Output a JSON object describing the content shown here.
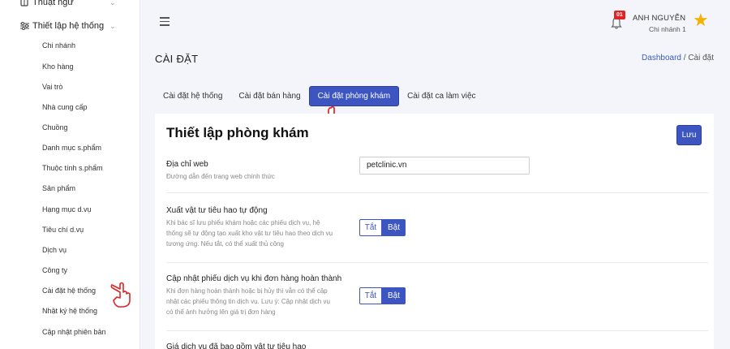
{
  "sidebar": {
    "group_top": {
      "label": "Thuật ngữ",
      "icon": "book-icon"
    },
    "group_settings": {
      "label": "Thiết lập hệ thống",
      "icon": "sliders-icon"
    },
    "items": [
      {
        "label": "Chi nhánh"
      },
      {
        "label": "Kho hàng"
      },
      {
        "label": "Vai trò"
      },
      {
        "label": "Nhà cung cấp"
      },
      {
        "label": "Chuồng"
      },
      {
        "label": "Danh mục s.phẩm"
      },
      {
        "label": "Thuộc tính s.phẩm"
      },
      {
        "label": "Sản phẩm"
      },
      {
        "label": "Hạng mục d.vụ"
      },
      {
        "label": "Tiêu chí d.vụ"
      },
      {
        "label": "Dịch vụ"
      },
      {
        "label": "Công ty"
      },
      {
        "label": "Cài đặt hệ thống"
      },
      {
        "label": "Nhật ký hệ thống"
      },
      {
        "label": "Cập nhật phiên bản"
      }
    ]
  },
  "header": {
    "notification_count": "01",
    "user_name": "ANH NGUYỄN",
    "user_branch": "Chi nhánh 1"
  },
  "page": {
    "title": "CÀI ĐẶT",
    "breadcrumb_home": "Dashboard",
    "breadcrumb_sep": "/",
    "breadcrumb_current": "Cài đặt"
  },
  "tabs": [
    {
      "label": "Cài đặt hệ thống",
      "active": false
    },
    {
      "label": "Cài đặt bán hàng",
      "active": false
    },
    {
      "label": "Cài đặt phòng khám",
      "active": true
    },
    {
      "label": "Cài đặt ca làm việc",
      "active": false
    }
  ],
  "card": {
    "title": "Thiết lập phòng khám",
    "save_label": "Lưu",
    "settings": [
      {
        "label": "Địa chỉ web",
        "desc": "Đường dẫn đến trang web chính thức",
        "value": "petclinic.vn"
      },
      {
        "label": "Xuất vật tư tiêu hao tự động",
        "desc": "Khi bác sĩ lưu phiếu khám hoặc các phiếu dịch vụ, hệ thống sẽ tự động tạo xuất kho vật tư tiêu hao theo dịch vụ tương ứng. Nếu tắt, có thể xuất thủ công",
        "off_label": "Tắt",
        "on_label": "Bật",
        "value": "Bật"
      },
      {
        "label": "Cập nhật phiếu dịch vụ khi đơn hàng hoàn thành",
        "desc": "Khi đơn hàng hoàn thành hoặc bị hủy thì vẫn có thể cập nhật các phiếu thông tin dịch vụ. Lưu ý: Cập nhật dịch vụ có thể ảnh hưởng lên giá trị đơn hàng",
        "off_label": "Tắt",
        "on_label": "Bật",
        "value": "Bật"
      },
      {
        "label": "Giá dịch vụ đã bao gồm vật tư tiêu hao"
      }
    ]
  },
  "colors": {
    "primary": "#3d55c0",
    "badge": "#e02424",
    "star": "#f5b000",
    "cursor": "#e02424"
  }
}
